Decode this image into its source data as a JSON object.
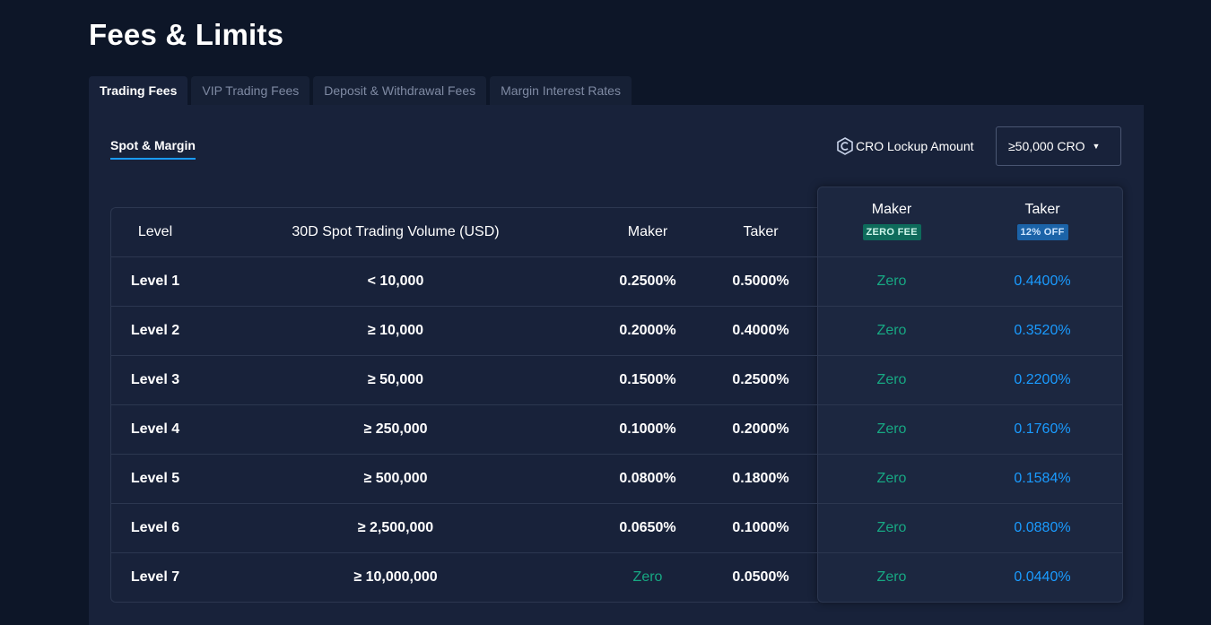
{
  "page_title": "Fees & Limits",
  "tabs": [
    {
      "label": "Trading Fees",
      "active": true
    },
    {
      "label": "VIP Trading Fees",
      "active": false
    },
    {
      "label": "Deposit & Withdrawal Fees",
      "active": false
    },
    {
      "label": "Margin Interest Rates",
      "active": false
    }
  ],
  "subtab": {
    "label": "Spot & Margin"
  },
  "cro_lockup": {
    "label": "CRO Lockup Amount",
    "selected": "≥50,000 CRO"
  },
  "table": {
    "headers": {
      "level": "Level",
      "volume": "30D Spot Trading Volume (USD)",
      "maker": "Maker",
      "taker": "Taker",
      "cro_maker": "Maker",
      "cro_maker_badge": "ZERO FEE",
      "cro_taker": "Taker",
      "cro_taker_badge": "12% OFF"
    },
    "rows": [
      {
        "level": "Level 1",
        "volume": "< 10,000",
        "maker": "0.2500%",
        "taker": "0.5000%",
        "cro_maker": "Zero",
        "cro_taker": "0.4400%"
      },
      {
        "level": "Level 2",
        "volume": "≥ 10,000",
        "maker": "0.2000%",
        "taker": "0.4000%",
        "cro_maker": "Zero",
        "cro_taker": "0.3520%"
      },
      {
        "level": "Level 3",
        "volume": "≥ 50,000",
        "maker": "0.1500%",
        "taker": "0.2500%",
        "cro_maker": "Zero",
        "cro_taker": "0.2200%"
      },
      {
        "level": "Level 4",
        "volume": "≥ 250,000",
        "maker": "0.1000%",
        "taker": "0.2000%",
        "cro_maker": "Zero",
        "cro_taker": "0.1760%"
      },
      {
        "level": "Level 5",
        "volume": "≥ 500,000",
        "maker": "0.0800%",
        "taker": "0.1800%",
        "cro_maker": "Zero",
        "cro_taker": "0.1584%"
      },
      {
        "level": "Level 6",
        "volume": "≥ 2,500,000",
        "maker": "0.0650%",
        "taker": "0.1000%",
        "cro_maker": "Zero",
        "cro_taker": "0.0880%"
      },
      {
        "level": "Level 7",
        "volume": "≥ 10,000,000",
        "maker": "Zero",
        "taker": "0.0500%",
        "cro_maker": "Zero",
        "cro_taker": "0.0440%"
      }
    ]
  },
  "colors": {
    "background": "#0d1628",
    "panel": "#18223a",
    "accent_blue": "#1a9bff",
    "zero_green": "#17a883"
  },
  "icons": {
    "cro": "cro-coin-icon",
    "dropdown": "caret-down-icon"
  }
}
